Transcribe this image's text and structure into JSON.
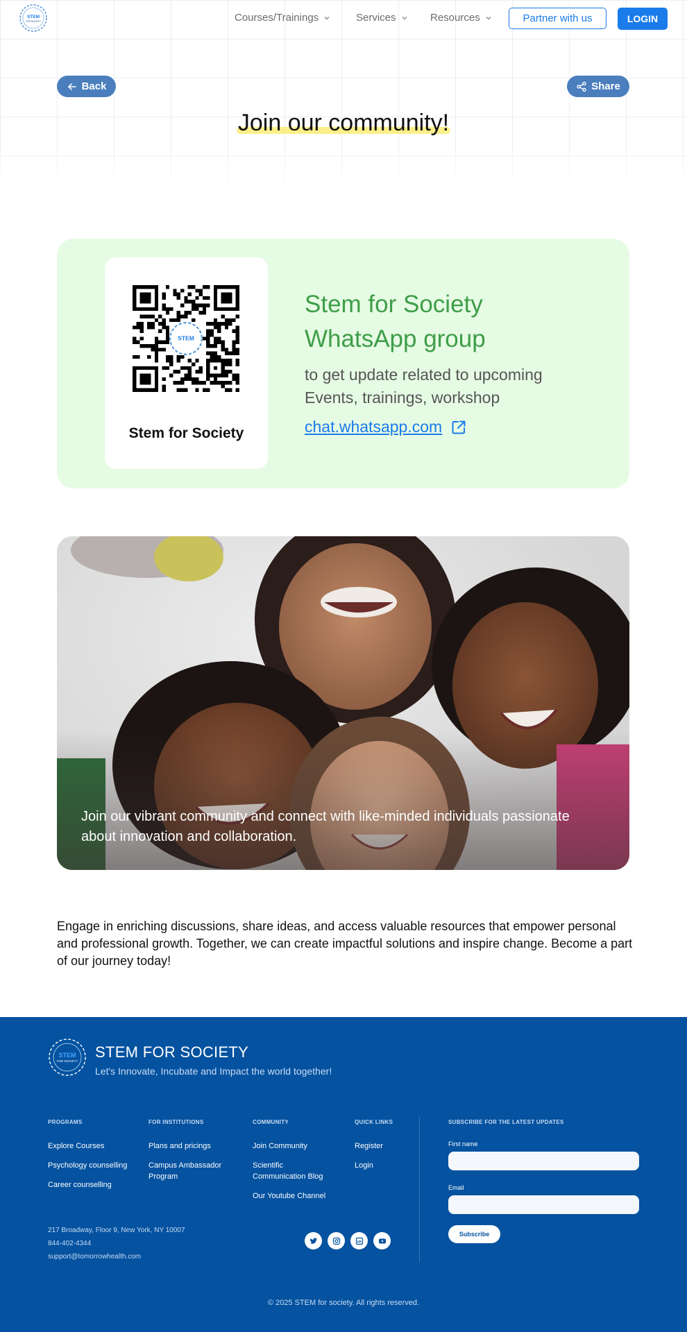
{
  "nav": {
    "logo_alt": "STEM for society logo",
    "logo_text_top": "STEM",
    "logo_text_bottom": "FOR SOCIETY",
    "items": [
      {
        "label": "Courses/Trainings"
      },
      {
        "label": "Services"
      },
      {
        "label": "Resources"
      }
    ],
    "partner_label": "Partner with us",
    "login_label": "LOGIN"
  },
  "header": {
    "back_label": "Back",
    "share_label": "Share",
    "title": "Join our community!"
  },
  "whatsapp": {
    "qr_caption": "Stem for Society",
    "title": "Stem for Society WhatsApp group",
    "subtitle": "to get update related to upcoming Events, trainings, workshop",
    "link_text": "chat.whatsapp.com",
    "title_color": "#3e9e48",
    "bg_color": "#e6fbe4"
  },
  "photo": {
    "caption": "Join our vibrant community and connect with like-minded individuals passionate about innovation and collaboration."
  },
  "body": {
    "text": "Engage in enriching discussions, share ideas, and access valuable resources that empower personal and professional growth. Together, we can create impactful solutions and inspire change. Become a part of our journey today!"
  },
  "footer": {
    "brand": "STEM FOR SOCIETY",
    "tagline": "Let's Innovate, Incubate and Impact the world together!",
    "columns": [
      {
        "heading": "PROGRAMS",
        "links": [
          "Explore Courses",
          "Psychology counselling",
          "Career counselling"
        ]
      },
      {
        "heading": "FOR INSTITUTIONS",
        "links": [
          "Plans and pricings",
          "Campus Ambassador Program"
        ]
      },
      {
        "heading": "COMMUNITY",
        "links": [
          "Join Community",
          "Scientific Communication Blog",
          "Our Youtube Channel"
        ]
      },
      {
        "heading": "QUICK LINKS",
        "links": [
          "Register",
          "Login"
        ]
      }
    ],
    "subscribe": {
      "heading": "SUBSCRIBE FOR THE LATEST UPDATES",
      "first_name_label": "First name",
      "email_label": "Email",
      "button_label": "Subscribe"
    },
    "address": "217 Broadway, Floor 9, New York, NY 10007",
    "phone": "844-402-4344",
    "email": "support@tomorrowhealth.com",
    "socials": [
      "twitter-icon",
      "instagram-icon",
      "linkedin-icon",
      "youtube-icon"
    ],
    "copyright": "© 2025 STEM for society. All rights reserved.",
    "bg_color": "#0452a0"
  }
}
